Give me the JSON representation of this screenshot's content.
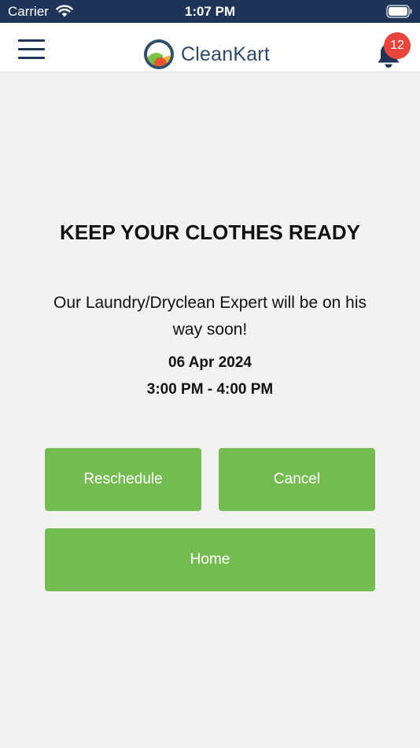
{
  "status_bar": {
    "carrier": "Carrier",
    "time": "1:07 PM",
    "background": "#1e3458"
  },
  "nav": {
    "menu_icon": "hamburger-menu-icon",
    "logo_text": "CleanKart",
    "bell_icon": "notification-bell-icon",
    "notification_count": "12",
    "badge_color": "#e8453c"
  },
  "confirmation": {
    "headline": "KEEP YOUR CLOTHES READY",
    "message": "Our Laundry/Dryclean Expert will be on his way soon!",
    "date": "06 Apr 2024",
    "time_slot": "3:00 PM - 4:00 PM"
  },
  "actions": {
    "reschedule_label": "Reschedule",
    "cancel_label": "Cancel",
    "home_label": "Home",
    "button_color": "#74bc51"
  }
}
